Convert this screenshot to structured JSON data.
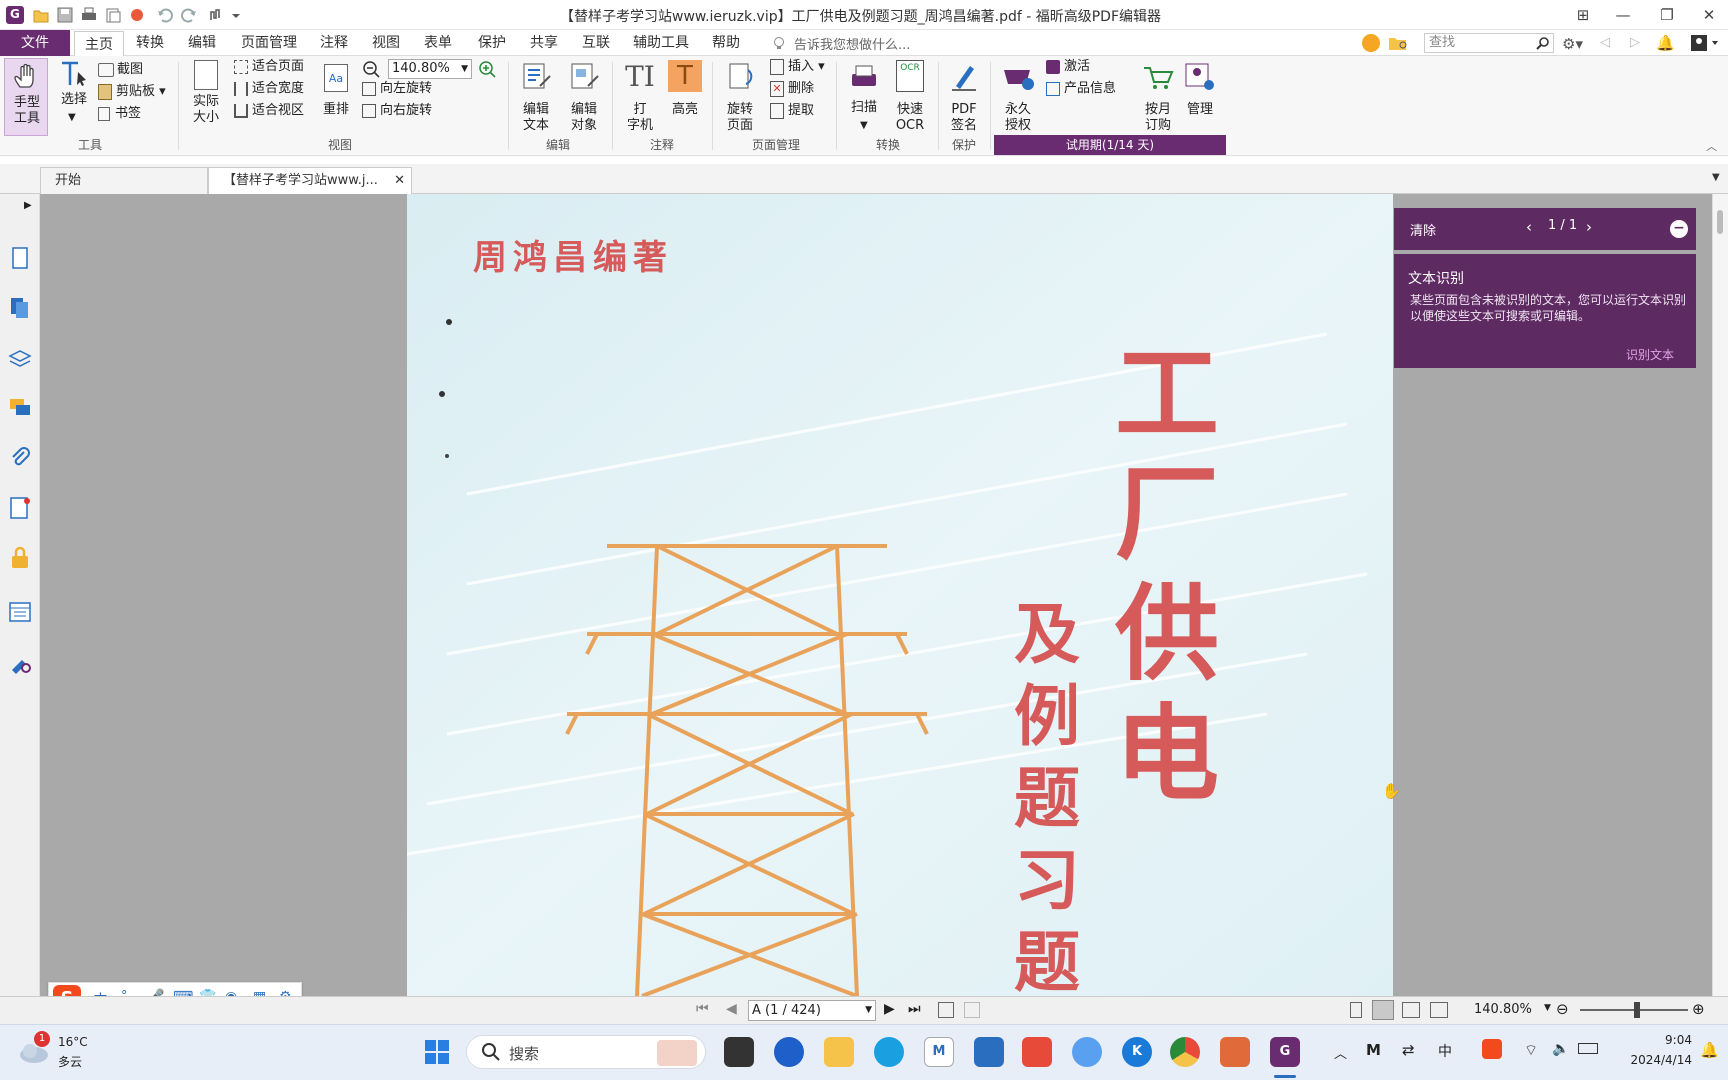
{
  "window": {
    "title": "【替样子考学习站www.ieruzk.vip】工厂供电及例题习题_周鸿昌编著.pdf - 福昕高级PDF编辑器"
  },
  "menubar": {
    "file": "文件",
    "tabs": [
      "主页",
      "转换",
      "编辑",
      "页面管理",
      "注释",
      "视图",
      "表单",
      "保护",
      "共享",
      "互联",
      "辅助工具",
      "帮助"
    ],
    "tell_me": "告诉我您想做什么...",
    "search_placeholder": "查找"
  },
  "ribbon": {
    "hand": "手型\n工具",
    "select": "选择",
    "screenshot": "截图",
    "clipboard": "剪贴板",
    "bookmark": "书签",
    "group_tools": "工具",
    "actual_size": "实际\n大小",
    "fit_page": "适合页面",
    "fit_width": "适合宽度",
    "fit_view": "适合视区",
    "reflow": "重排",
    "zoom_value": "140.80%",
    "rotate_left": "向左旋转",
    "rotate_right": "向右旋转",
    "group_view": "视图",
    "edit_text": "编辑\n文本",
    "edit_object": "编辑\n对象",
    "group_edit": "编辑",
    "typewriter": "打\n字机",
    "highlight": "高亮",
    "group_annotate": "注释",
    "rotate_page": "旋转\n页面",
    "insert": "插入",
    "delete": "删除",
    "extract": "提取",
    "group_pages": "页面管理",
    "scan": "扫描",
    "quick_ocr": "快速\nOCR",
    "group_convert": "转换",
    "pdf_sign": "PDF\n签名",
    "group_protect": "保护",
    "perm_license": "永久\n授权",
    "activate": "激活",
    "product_info": "产品信息",
    "monthly": "按月\n订购",
    "manage": "管理",
    "trial": "试用期(1/14 天)"
  },
  "tabs": {
    "start": "开始",
    "doc": "【替样子考学习站www.j..."
  },
  "ocr_panel": {
    "clear": "清除",
    "counter": "1 / 1",
    "heading": "文本识别",
    "body": "某些页面包含未被识别的文本，您可以运行文本识别以便使这些文本可搜索或可编辑。",
    "action": "识别文本"
  },
  "page_content": {
    "author": "周鸿昌编著",
    "title_main": [
      "工",
      "厂",
      "供",
      "电"
    ],
    "title_sub": [
      "及",
      "例",
      "题",
      "习",
      "题"
    ]
  },
  "statusbar": {
    "page_field": "A (1 / 424)",
    "zoom": "140.80%"
  },
  "taskbar": {
    "weather_temp": "16°C",
    "weather_desc": "多云",
    "weather_badge": "1",
    "search": "搜索",
    "ime": "中",
    "time": "9:04",
    "date": "2024/4/14"
  },
  "colors": {
    "accent": "#6a2c70",
    "title_red": "#d65a5a",
    "tower_orange": "#e8a25a",
    "page_bg": "#e7f3f6"
  }
}
